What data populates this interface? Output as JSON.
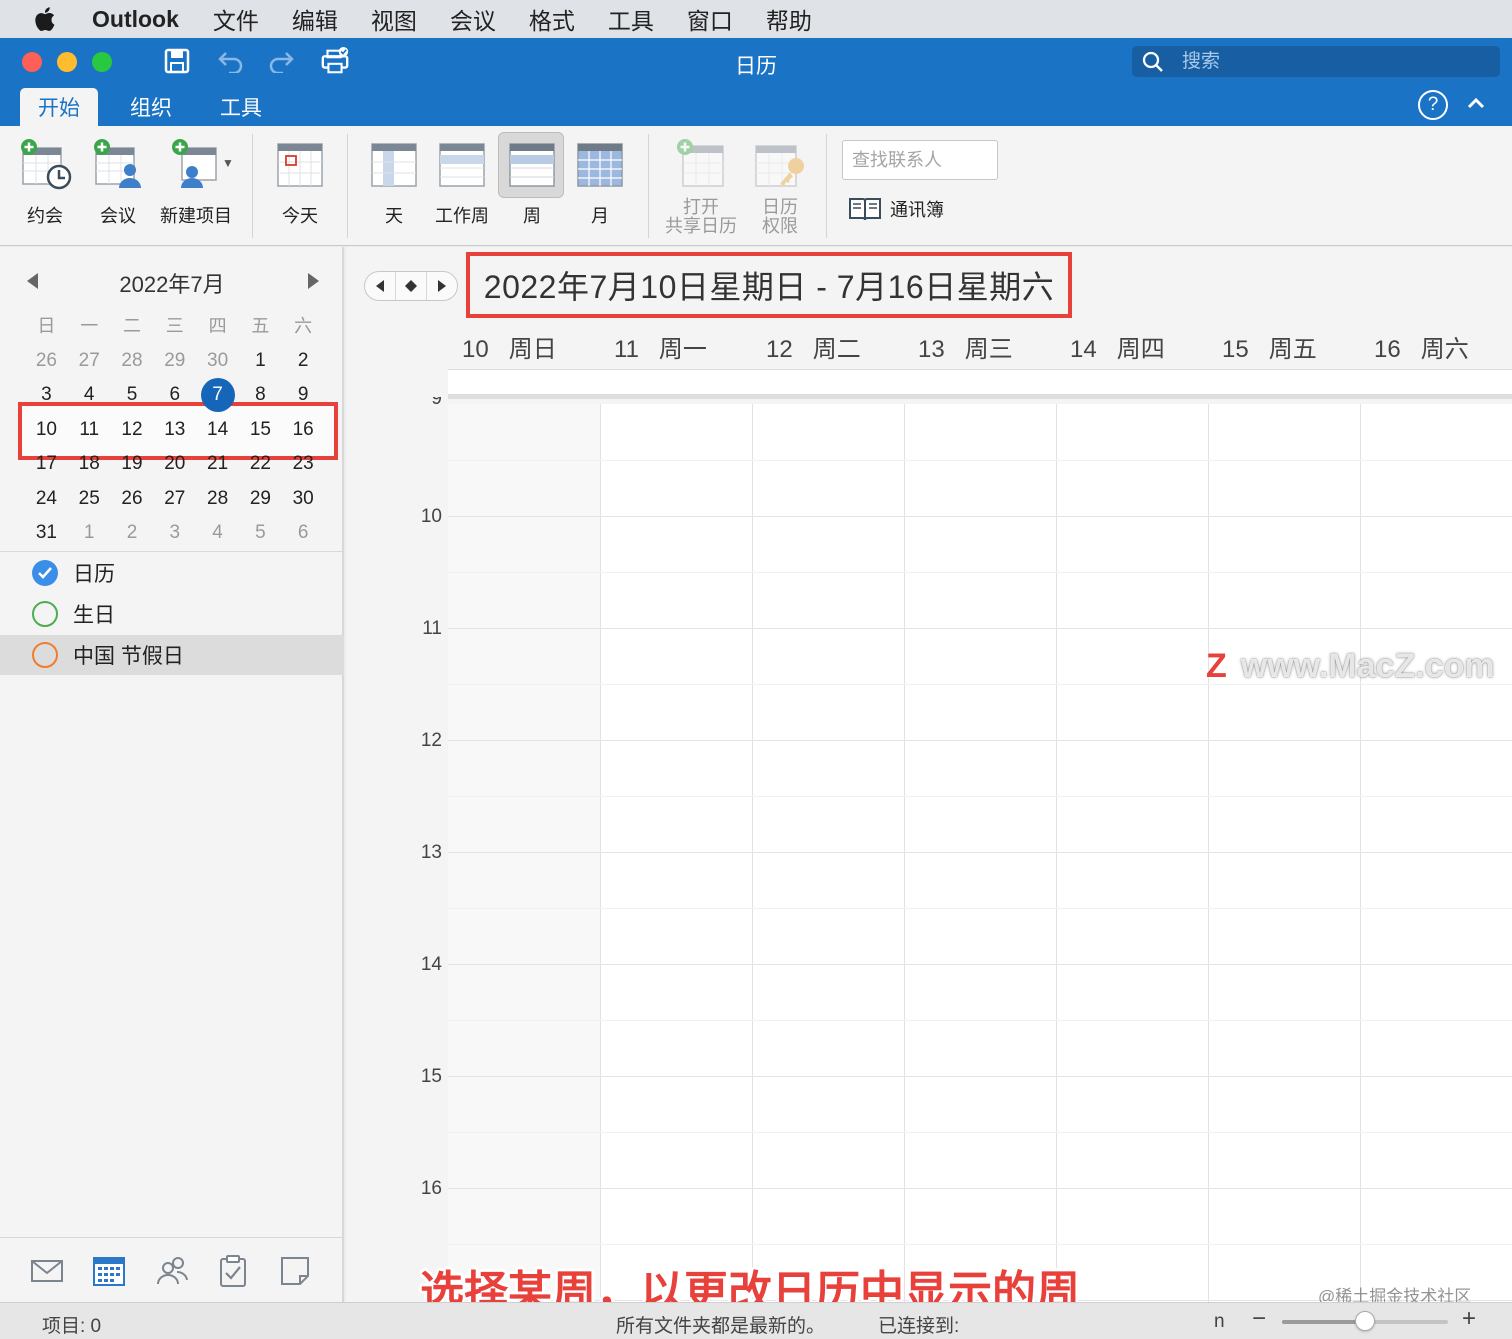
{
  "menubar": {
    "app_name": "Outlook",
    "items": [
      "文件",
      "编辑",
      "视图",
      "会议",
      "格式",
      "工具",
      "窗口",
      "帮助"
    ]
  },
  "window": {
    "title": "日历",
    "search_placeholder": "搜索",
    "traffic_colors": [
      "#fe5f57",
      "#febc2e",
      "#28c840"
    ]
  },
  "ribbon_tabs": [
    {
      "label": "开始",
      "active": true
    },
    {
      "label": "组织",
      "active": false
    },
    {
      "label": "工具",
      "active": false
    }
  ],
  "ribbon": {
    "appointment": "约会",
    "meeting": "会议",
    "new_item": "新建项目",
    "today": "今天",
    "day": "天",
    "work_week": "工作周",
    "week": "周",
    "month": "月",
    "open_shared_1": "打开",
    "open_shared_2": "共享日历",
    "permissions_1": "日历",
    "permissions_2": "权限",
    "contact_search_placeholder": "查找联系人",
    "address_book": "通讯簿"
  },
  "mini_calendar": {
    "title": "2022年7月",
    "weekdays": [
      "日",
      "一",
      "二",
      "三",
      "四",
      "五",
      "六"
    ],
    "weeks": [
      [
        "26",
        "27",
        "28",
        "29",
        "30",
        "1",
        "2"
      ],
      [
        "3",
        "4",
        "5",
        "6",
        "7",
        "8",
        "9"
      ],
      [
        "10",
        "11",
        "12",
        "13",
        "14",
        "15",
        "16"
      ],
      [
        "17",
        "18",
        "19",
        "20",
        "21",
        "22",
        "23"
      ],
      [
        "24",
        "25",
        "26",
        "27",
        "28",
        "29",
        "30"
      ],
      [
        "31",
        "1",
        "2",
        "3",
        "4",
        "5",
        "6"
      ]
    ],
    "today": "7",
    "selected_week_index": 2
  },
  "calendars": [
    {
      "name": "日历",
      "checked": true,
      "color": "#3b8ee8"
    },
    {
      "name": "生日",
      "checked": false,
      "color": "#4cae4f"
    },
    {
      "name": "中国 节假日",
      "checked": false,
      "color": "#ef7d2f"
    }
  ],
  "main": {
    "date_range": "2022年7月10日星期日 - 7月16日星期六",
    "days": [
      {
        "num": "10",
        "name": "周日"
      },
      {
        "num": "11",
        "name": "周一"
      },
      {
        "num": "12",
        "name": "周二"
      },
      {
        "num": "13",
        "name": "周三"
      },
      {
        "num": "14",
        "name": "周四"
      },
      {
        "num": "15",
        "name": "周五"
      },
      {
        "num": "16",
        "name": "周六"
      }
    ],
    "hours": [
      "9",
      "10",
      "11",
      "12",
      "13",
      "14",
      "15",
      "16"
    ],
    "watermark": "www.MacZ.com",
    "watermark_logo": "Z"
  },
  "caption": "选择某周，以更改日历中显示的周",
  "credit": "@稀土掘金技术社区",
  "status": {
    "items": "项目: 0",
    "sync": "所有文件夹都是最新的。",
    "connected": "已连接到:",
    "extra": "n",
    "zoom_minus": "−",
    "zoom_plus": "+",
    "zoom_level": 0.5
  },
  "colors": {
    "accent": "#1a73c4",
    "highlight_box": "#e8403a",
    "today_circle": "#1565b8"
  }
}
